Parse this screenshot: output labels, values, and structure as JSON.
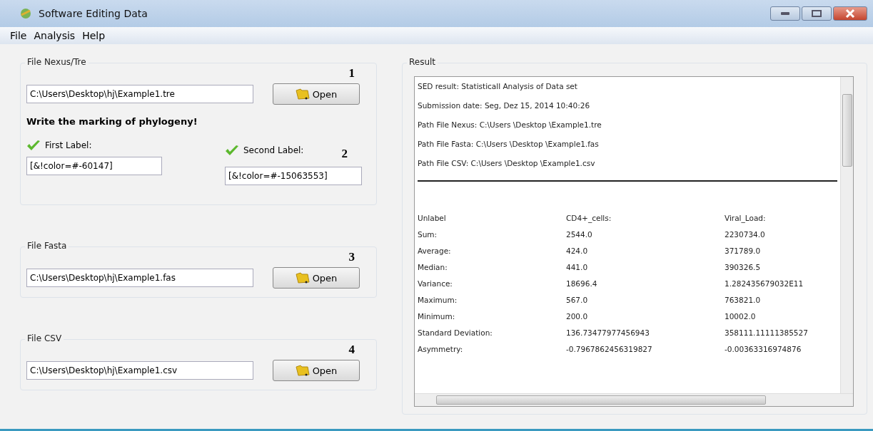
{
  "window": {
    "title": "Software Editing Data"
  },
  "menu": [
    "File",
    "Analysis",
    "Help"
  ],
  "file_panels": [
    {
      "legend": "File Nexus/Tre",
      "callout": "1",
      "path": "C:\\Users\\Desktop\\hj\\Example1.tre",
      "button": "Open",
      "prompt": "Write the marking of phylogeny!",
      "labels": [
        {
          "label": "First Label:",
          "value": "[&!color=#-60147]"
        },
        {
          "label": "Second Label:",
          "value": "[&!color=#-15063553]",
          "callout": "2"
        }
      ]
    },
    {
      "legend": "File Fasta",
      "callout": "3",
      "path": "C:\\Users\\Desktop\\hj\\Example1.fas",
      "button": "Open"
    },
    {
      "legend": "File CSV",
      "callout": "4",
      "path": "C:\\Users\\Desktop\\hj\\Example1.csv",
      "button": "Open"
    }
  ],
  "result": {
    "legend": "Result",
    "header_lines": [
      "SED result: Statisticall Analysis of Data set",
      "Submission date: Seg, Dez 15, 2014 10:40:26",
      "Path File Nexus: C:\\Users \\Desktop \\Example1.tre",
      "Path File Fasta: C:\\Users \\Desktop \\Example1.fas",
      "Path File CSV: C:\\Users \\Desktop \\Example1.csv"
    ],
    "columns": [
      "Unlabel",
      "CD4+_cells:",
      "Viral_Load:"
    ],
    "rows": [
      [
        "Sum:",
        "2544.0",
        "2230734.0"
      ],
      [
        "Average:",
        "424.0",
        "371789.0"
      ],
      [
        "Median:",
        "441.0",
        "390326.5"
      ],
      [
        "Variance:",
        "18696.4",
        "1.282435679032E11"
      ],
      [
        "Maximum:",
        "567.0",
        "763821.0"
      ],
      [
        "Minimum:",
        "200.0",
        "10002.0"
      ],
      [
        "Standard Deviation:",
        "136.73477977456943",
        "358111.11111385527"
      ],
      [
        "Asymmetry:",
        "-0.7967862456319827",
        "-0.00363316974876"
      ]
    ]
  }
}
